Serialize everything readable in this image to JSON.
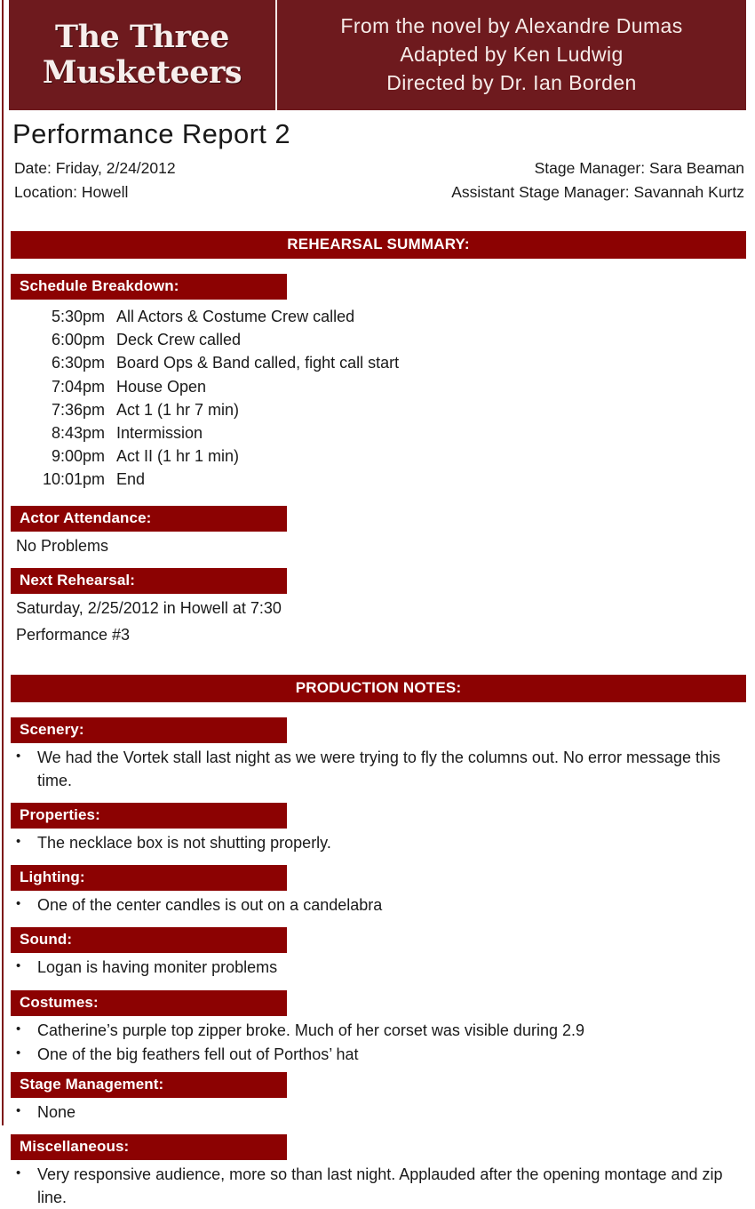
{
  "theme": {
    "masthead_bg": "#6e1a1e",
    "bar_bg": "#8c0202",
    "bar_text": "#ffffff",
    "body_text": "#1a1a1a",
    "page_bg": "#ffffff"
  },
  "masthead": {
    "show_title_line1": "The Three",
    "show_title_line2": "Musketeers",
    "credits": [
      "From the novel by Alexandre Dumas",
      "Adapted by Ken Ludwig",
      "Directed by Dr. Ian Borden"
    ]
  },
  "report": {
    "title": "Performance Report 2",
    "left_meta": [
      "Date: Friday, 2/24/2012",
      "Location: Howell"
    ],
    "right_meta": [
      "Stage Manager: Sara Beaman",
      "Assistant Stage Manager: Savannah Kurtz"
    ]
  },
  "rehearsal_summary": {
    "heading": "REHEARSAL SUMMARY:",
    "schedule": {
      "heading": "Schedule Breakdown:",
      "rows": [
        {
          "time": "5:30pm",
          "desc": "All Actors & Costume Crew called"
        },
        {
          "time": "6:00pm",
          "desc": "Deck Crew called"
        },
        {
          "time": "6:30pm",
          "desc": "Board Ops & Band called, fight call start"
        },
        {
          "time": "7:04pm",
          "desc": "House Open"
        },
        {
          "time": "7:36pm",
          "desc": "Act 1 (1 hr 7 min)"
        },
        {
          "time": "8:43pm",
          "desc": "Intermission"
        },
        {
          "time": "9:00pm",
          "desc": "Act II (1 hr 1 min)"
        },
        {
          "time": "10:01pm",
          "desc": "End"
        }
      ]
    },
    "actor_attendance": {
      "heading": "Actor Attendance:",
      "lines": [
        "No Problems"
      ]
    },
    "next_rehearsal": {
      "heading": "Next Rehearsal:",
      "lines": [
        "Saturday, 2/25/2012 in Howell at 7:30",
        "Performance #3"
      ]
    }
  },
  "production_notes": {
    "heading": "PRODUCTION NOTES:",
    "bullet_glyph": "•",
    "sections": [
      {
        "heading": "Scenery:",
        "bullets": [
          "We had the Vortek stall last night as we were trying to fly the columns out. No error message this time."
        ]
      },
      {
        "heading": "Properties:",
        "bullets": [
          "The necklace box is not shutting properly."
        ]
      },
      {
        "heading": "Lighting:",
        "bullets": [
          "One of the center candles is out on a candelabra"
        ]
      },
      {
        "heading": "Sound:",
        "bullets": [
          "Logan is having moniter problems"
        ]
      },
      {
        "heading": "Costumes:",
        "bullets": [
          "Catherine’s purple  top zipper broke. Much of her corset was visible during 2.9",
          "One of the big feathers fell out of Porthos’ hat"
        ]
      },
      {
        "heading": "Stage Management:",
        "bullets": [
          "None"
        ]
      },
      {
        "heading": "Miscellaneous:",
        "bullets": [
          "Very responsive audience, more so than last night. Applauded after the opening montage and zip line."
        ]
      }
    ]
  }
}
